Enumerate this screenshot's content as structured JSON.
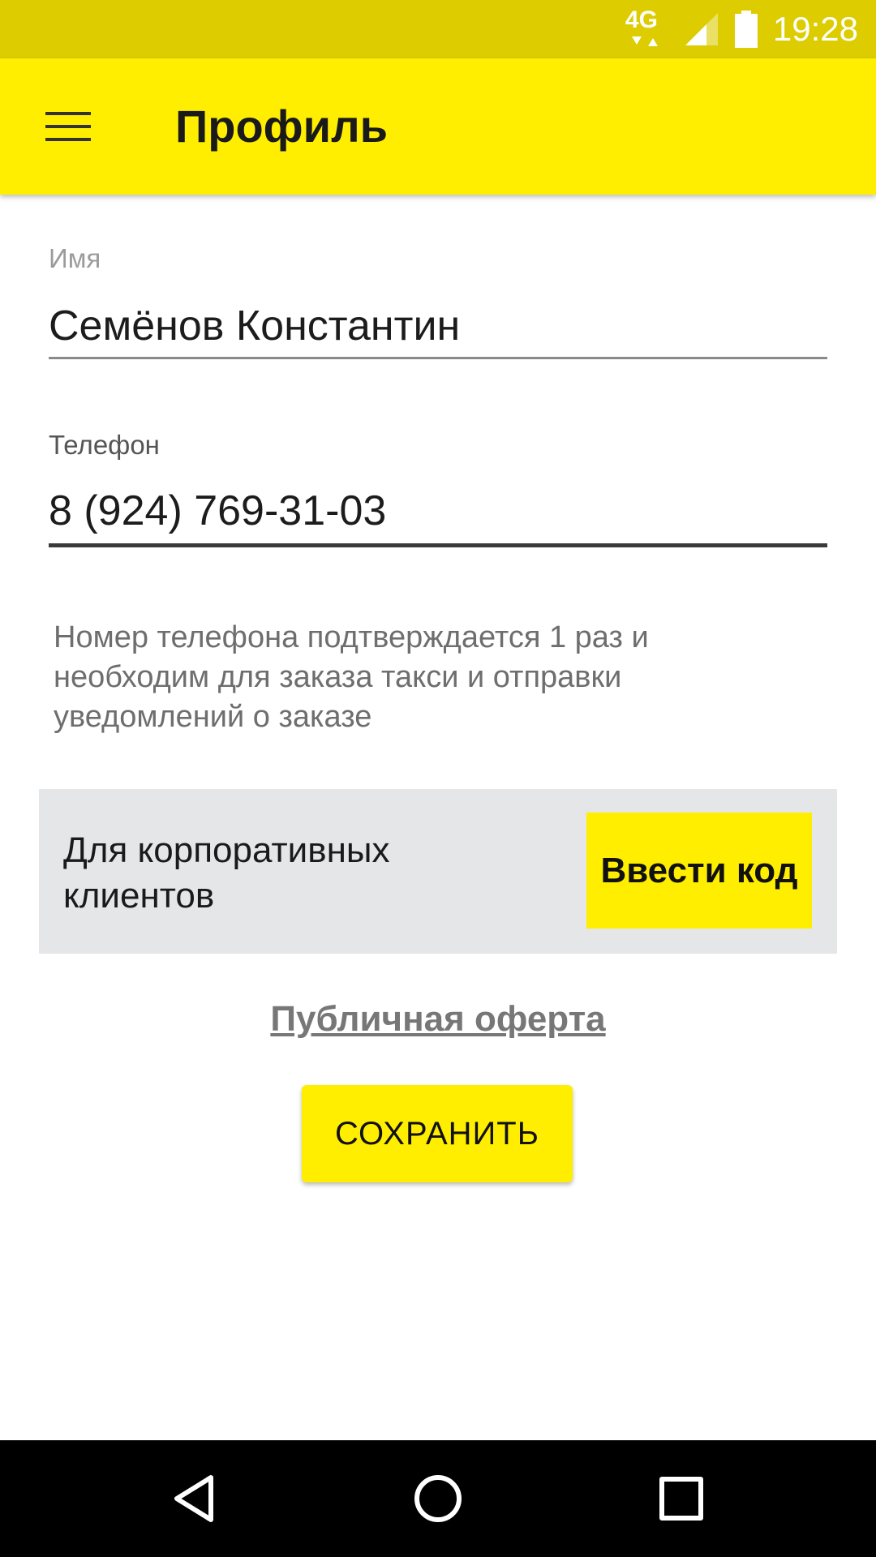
{
  "status_bar": {
    "network": "4G",
    "time": "19:28"
  },
  "app_bar": {
    "title": "Профиль"
  },
  "form": {
    "name": {
      "label": "Имя",
      "value": "Семёнов Константин"
    },
    "phone": {
      "label": "Телефон",
      "value": "8 (924) 769-31-03"
    },
    "hint": "Номер телефона подтверждается 1 раз и необходим для заказа такси и отправки уведомлений о заказе"
  },
  "corporate": {
    "text": "Для корпоративных клиентов",
    "button_label": "Ввести код"
  },
  "offer_link": "Публичная оферта",
  "save_label": "СОХРАНИТЬ",
  "colors": {
    "accent": "#ffee00",
    "status_bar": "#dccc00",
    "corp_card": "#e5e6e7"
  },
  "icons": {
    "menu": "hamburger-menu-icon",
    "signal": "signal-icon",
    "battery": "battery-icon",
    "back": "nav-back-icon",
    "home": "nav-home-icon",
    "recent": "nav-recent-icon"
  }
}
